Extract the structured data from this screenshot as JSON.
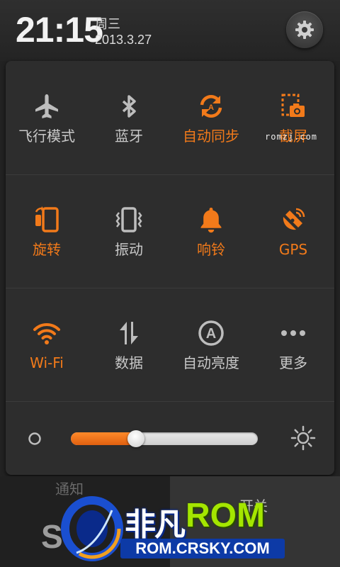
{
  "header": {
    "time": "21:15",
    "weekday": "周三",
    "date": "2013.3.27",
    "settings_icon": "gear-icon"
  },
  "colors": {
    "accent_on": "#f27a1a",
    "label_off": "#c9c9c9",
    "panel_bg": "#2d2d2d"
  },
  "toggles": [
    {
      "label": "飞行模式",
      "icon": "airplane-icon",
      "state": "off"
    },
    {
      "label": "蓝牙",
      "icon": "bluetooth-icon",
      "state": "off"
    },
    {
      "label": "自动同步",
      "icon": "sync-icon",
      "state": "on"
    },
    {
      "label": "截屏",
      "icon": "screenshot-icon",
      "state": "on"
    },
    {
      "label": "旋转",
      "icon": "rotate-icon",
      "state": "on"
    },
    {
      "label": "振动",
      "icon": "vibrate-icon",
      "state": "off"
    },
    {
      "label": "响铃",
      "icon": "bell-icon",
      "state": "on"
    },
    {
      "label": "GPS",
      "icon": "gps-icon",
      "state": "on"
    },
    {
      "label": "Wi-Fi",
      "icon": "wifi-icon",
      "state": "on"
    },
    {
      "label": "数据",
      "icon": "data-icon",
      "state": "off"
    },
    {
      "label": "自动亮度",
      "icon": "auto-brightness-icon",
      "state": "off"
    },
    {
      "label": "更多",
      "icon": "more-icon",
      "state": "off"
    }
  ],
  "brightness": {
    "level": 0.32,
    "low_icon": "brightness-low-icon",
    "high_icon": "brightness-high-icon"
  },
  "watermark_small": "romzj.com",
  "bottom_tabs": {
    "left": "通知",
    "right": "开关"
  },
  "logo": {
    "cn": "非凡",
    "rom": "ROM",
    "url": "ROM.CRSKY.COM"
  }
}
